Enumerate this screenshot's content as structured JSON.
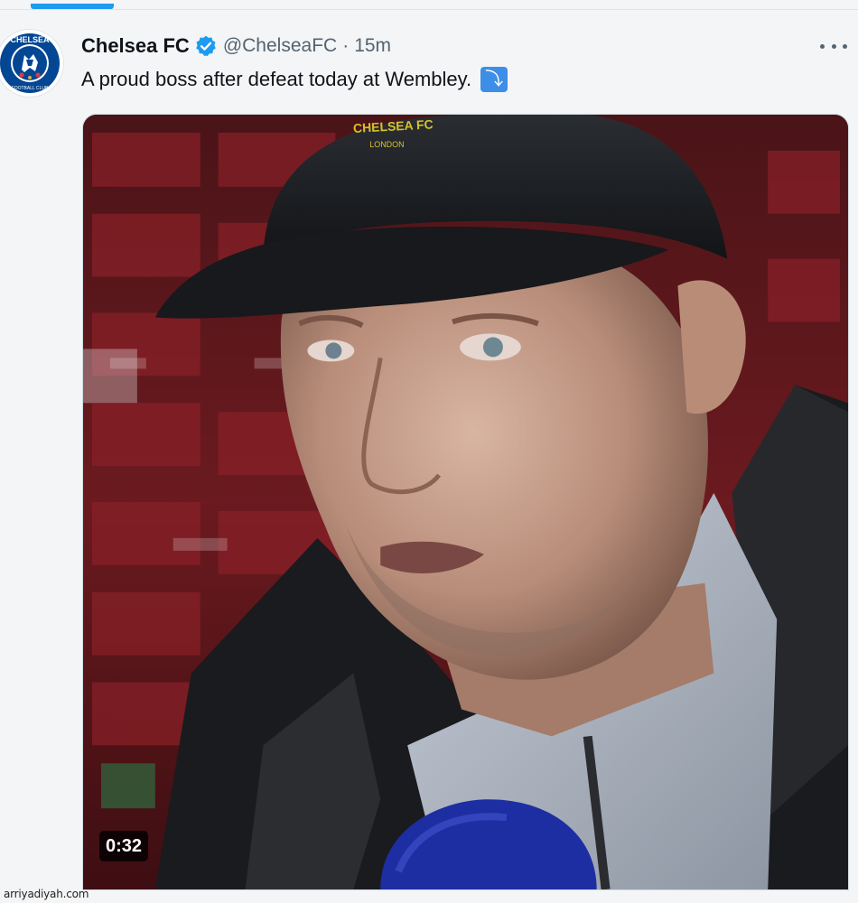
{
  "tweet": {
    "display_name": "Chelsea FC",
    "handle": "@ChelseaFC",
    "separator": "·",
    "time": "15m",
    "text": "A proud boss after defeat today at Wembley.",
    "emoji": "⤵",
    "verified": true
  },
  "avatar": {
    "logo_text_top": "CHELSEA",
    "logo_text_bottom": "FOOTBALL CLUB",
    "colors": {
      "blue": "#034694",
      "gold": "#d1b14a",
      "red": "#e03a3e"
    }
  },
  "media": {
    "type": "video",
    "duration": "0:32",
    "cap_text_line1": "CHELSEA FC",
    "cap_text_line2": "LONDON"
  },
  "watermark": "arriyadiyah.com",
  "colors": {
    "accent": "#1d9bf0",
    "text_secondary": "#536471",
    "background": "#f4f5f7"
  }
}
